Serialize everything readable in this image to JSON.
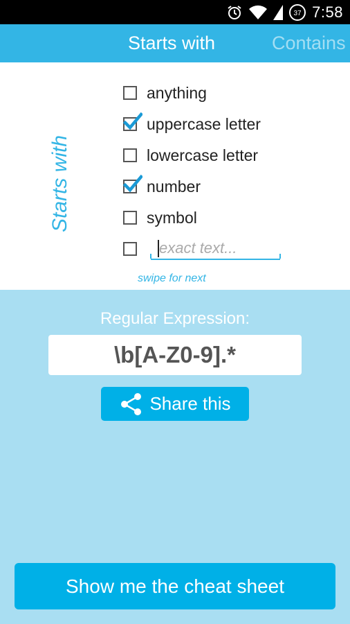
{
  "status_bar": {
    "time": "7:58",
    "battery": "37"
  },
  "tabs": [
    {
      "label": "Starts with",
      "active": true
    },
    {
      "label": "Contains",
      "active": false
    }
  ],
  "section_title": "Starts with",
  "options": [
    {
      "label": "anything",
      "checked": false
    },
    {
      "label": "uppercase letter",
      "checked": true
    },
    {
      "label": "lowercase letter",
      "checked": false
    },
    {
      "label": "number",
      "checked": true
    },
    {
      "label": "symbol",
      "checked": false
    }
  ],
  "exact_text": {
    "checked": false,
    "placeholder": "exact text...",
    "value": ""
  },
  "swipe_hint": "swipe for next",
  "regex": {
    "label": "Regular Expression:",
    "value": "\\b[A-Z0-9].*"
  },
  "share_button": "Share this",
  "cheat_sheet_button": "Show me the cheat sheet",
  "colors": {
    "accent": "#33b5e5",
    "button": "#00b0e7",
    "background": "#a9def2"
  }
}
